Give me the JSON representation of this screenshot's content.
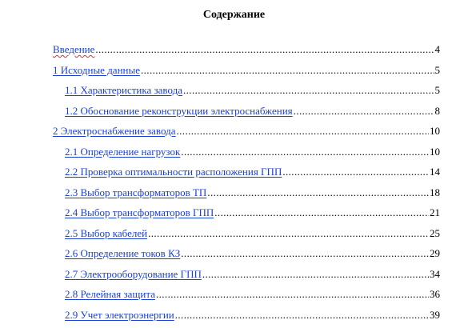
{
  "title": "Содержание",
  "entries": [
    {
      "text": "Введение",
      "page": "4",
      "level": 1,
      "flagged": true
    },
    {
      "text": "1 Исходные данные",
      "page": "5",
      "level": 1,
      "flagged": false
    },
    {
      "text": "1.1 Характеристика завода",
      "page": "5",
      "level": 2,
      "flagged": false
    },
    {
      "text": "1.2 Обоснование реконструкции электроснабжения",
      "page": "8",
      "level": 2,
      "flagged": false
    },
    {
      "text": "2 Электроснабжение завода",
      "page": "10",
      "level": 1,
      "flagged": false
    },
    {
      "text": "2.1 Определение нагрузок",
      "page": "10",
      "level": 2,
      "flagged": false
    },
    {
      "text": "2.2 Проверка оптимальности расположения ГПП",
      "page": "14",
      "level": 2,
      "flagged": false
    },
    {
      "text": "2.3 Выбор трансформаторов ТП",
      "page": "18",
      "level": 2,
      "flagged": false
    },
    {
      "text": "2.4 Выбор трансформаторов ГПП",
      "page": "21",
      "level": 2,
      "flagged": false
    },
    {
      "text": "2.5 Выбор кабелей",
      "page": "25",
      "level": 2,
      "flagged": false
    },
    {
      "text": "2.6 Определение токов КЗ",
      "page": "29",
      "level": 2,
      "flagged": false
    },
    {
      "text": "2.7 Электрооборудование ГПП",
      "page": "34",
      "level": 2,
      "flagged": false
    },
    {
      "text": "2.8 Релейная защита",
      "page": "36",
      "level": 2,
      "flagged": false
    },
    {
      "text": "2.9 Учет электроэнергии",
      "page": "39",
      "level": 2,
      "flagged": false
    }
  ]
}
